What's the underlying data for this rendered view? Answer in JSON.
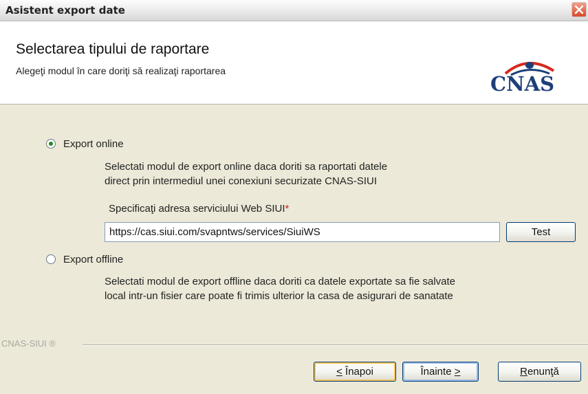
{
  "window": {
    "title": "Asistent export date"
  },
  "header": {
    "title": "Selectarea tipului de raportare",
    "subtitle": "Alegeţi modul în care doriţi să realizaţi raportarea",
    "logo_text": "CNAS"
  },
  "options": {
    "online": {
      "label": "Export online",
      "selected": true,
      "desc_line1": "Selectati modul de export online daca doriti sa raportati datele",
      "desc_line2": "direct prin intermediul unei conexiuni securizate CNAS-SIUI"
    },
    "service_field": {
      "label": "Specificaţi adresa serviciului Web SIUI",
      "required_mark": "*",
      "value": "https://cas.siui.com/svapntws/services/SiuiWS",
      "test_button": "Test"
    },
    "offline": {
      "label": "Export offline",
      "selected": false,
      "desc_line1": "Selectati modul de export offline daca doriti ca datele exportate sa fie salvate",
      "desc_line2": "local intr-un fisier care poate fi trimis ulterior la casa de asigurari de sanatate"
    }
  },
  "footer": {
    "brand": "CNAS-SIUI ®",
    "back_button": {
      "underline": "<",
      "rest": " Înapoi"
    },
    "next_button": {
      "rest": "Înainte ",
      "underline": ">"
    },
    "cancel_button": {
      "underline": "R",
      "rest": "enunţă"
    }
  },
  "colors": {
    "accent_blue": "#1d3f7a",
    "radio_green": "#1d8a1d",
    "required_red": "#d81e1e"
  }
}
